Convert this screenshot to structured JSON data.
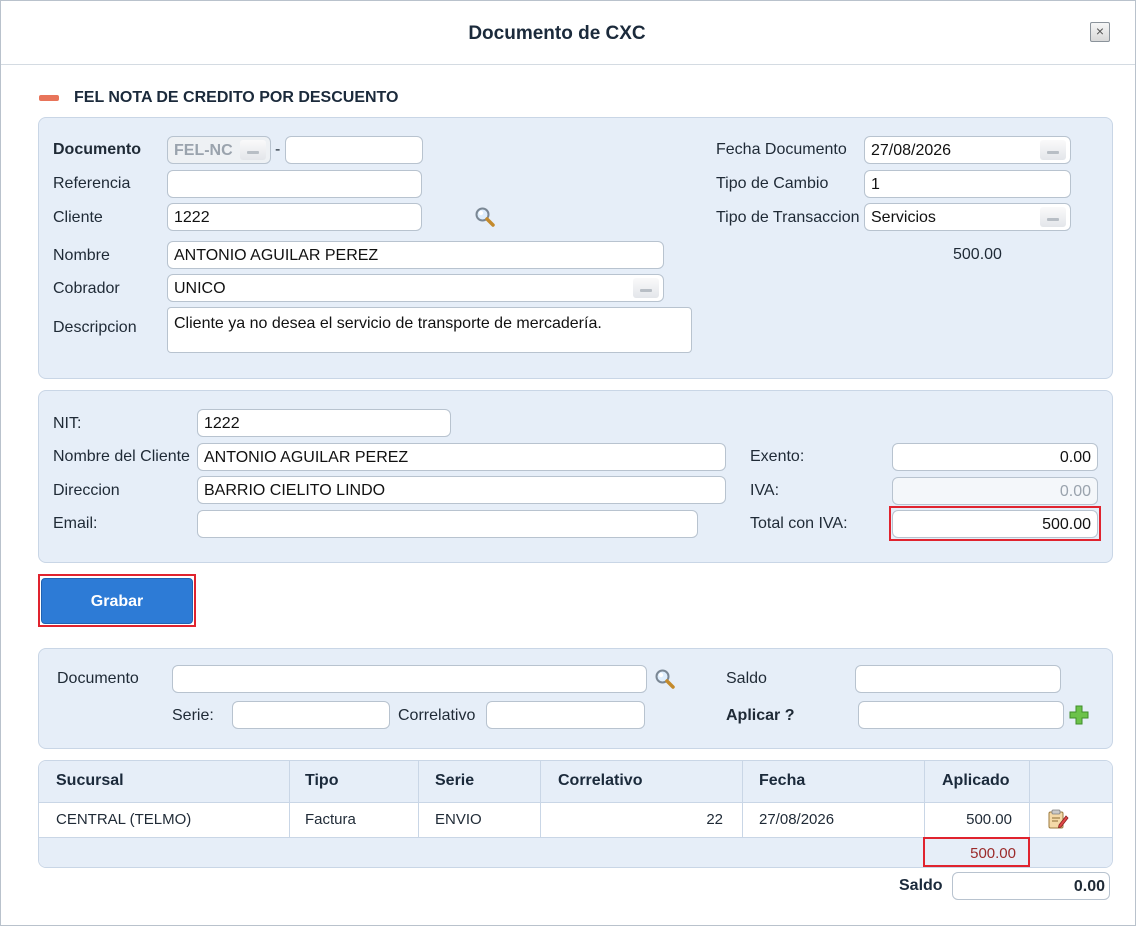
{
  "window": {
    "title": "Documento de CXC",
    "close_label": "×"
  },
  "section": {
    "title": "FEL NOTA DE CREDITO POR DESCUENTO"
  },
  "header_form": {
    "documento_label": "Documento",
    "documento_serie": "FEL-NC",
    "documento_sep": "-",
    "documento_numero": "",
    "referencia_label": "Referencia",
    "referencia_value": "",
    "cliente_label": "Cliente",
    "cliente_value": "1222",
    "nombre_label": "Nombre",
    "nombre_value": "ANTONIO AGUILAR PEREZ",
    "cobrador_label": "Cobrador",
    "cobrador_value": "UNICO",
    "descripcion_label": "Descripcion",
    "descripcion_value": "Cliente ya no desea el servicio de transporte de mercadería.",
    "fecha_label": "Fecha Documento",
    "fecha_value": "27/08/2026",
    "tipo_cambio_label": "Tipo de Cambio",
    "tipo_cambio_value": "1",
    "tipo_transaccion_label": "Tipo de Transaccion",
    "tipo_transaccion_value": "Servicios",
    "monto": "500.00"
  },
  "fiscal_form": {
    "nit_label": "NIT:",
    "nit_value": "1222",
    "nombre_cliente_label": "Nombre del Cliente",
    "nombre_cliente_value": "ANTONIO AGUILAR PEREZ",
    "direccion_label": "Direccion",
    "direccion_value": "BARRIO CIELITO LINDO",
    "email_label": "Email:",
    "email_value": "",
    "exento_label": "Exento:",
    "exento_value": "0.00",
    "iva_label": "IVA:",
    "iva_value": "0.00",
    "total_label": "Total con IVA:",
    "total_value": "500.00"
  },
  "actions": {
    "grabar_label": "Grabar"
  },
  "apply_form": {
    "documento_label": "Documento",
    "documento_value": "",
    "serie_label": "Serie:",
    "serie_value": "",
    "correlativo_label": "Correlativo",
    "correlativo_value": "",
    "saldo_label": "Saldo",
    "saldo_value": "",
    "aplicar_label": "Aplicar ?",
    "aplicar_value": ""
  },
  "grid": {
    "columns": [
      "Sucursal",
      "Tipo",
      "Serie",
      "Correlativo",
      "Fecha",
      "Aplicado"
    ],
    "rows": [
      {
        "sucursal": "CENTRAL (TELMO)",
        "tipo": "Factura",
        "serie": "ENVIO",
        "correlativo": "22",
        "fecha": "27/08/2026",
        "aplicado": "500.00"
      }
    ],
    "total_aplicado": "500.00"
  },
  "footer": {
    "saldo_label": "Saldo",
    "saldo_value": "0.00"
  },
  "colors": {
    "panel_bg": "#e6eef8",
    "primary_button": "#2d7bd6",
    "highlight": "#e0232e",
    "collapse_icon": "#e8745a"
  }
}
